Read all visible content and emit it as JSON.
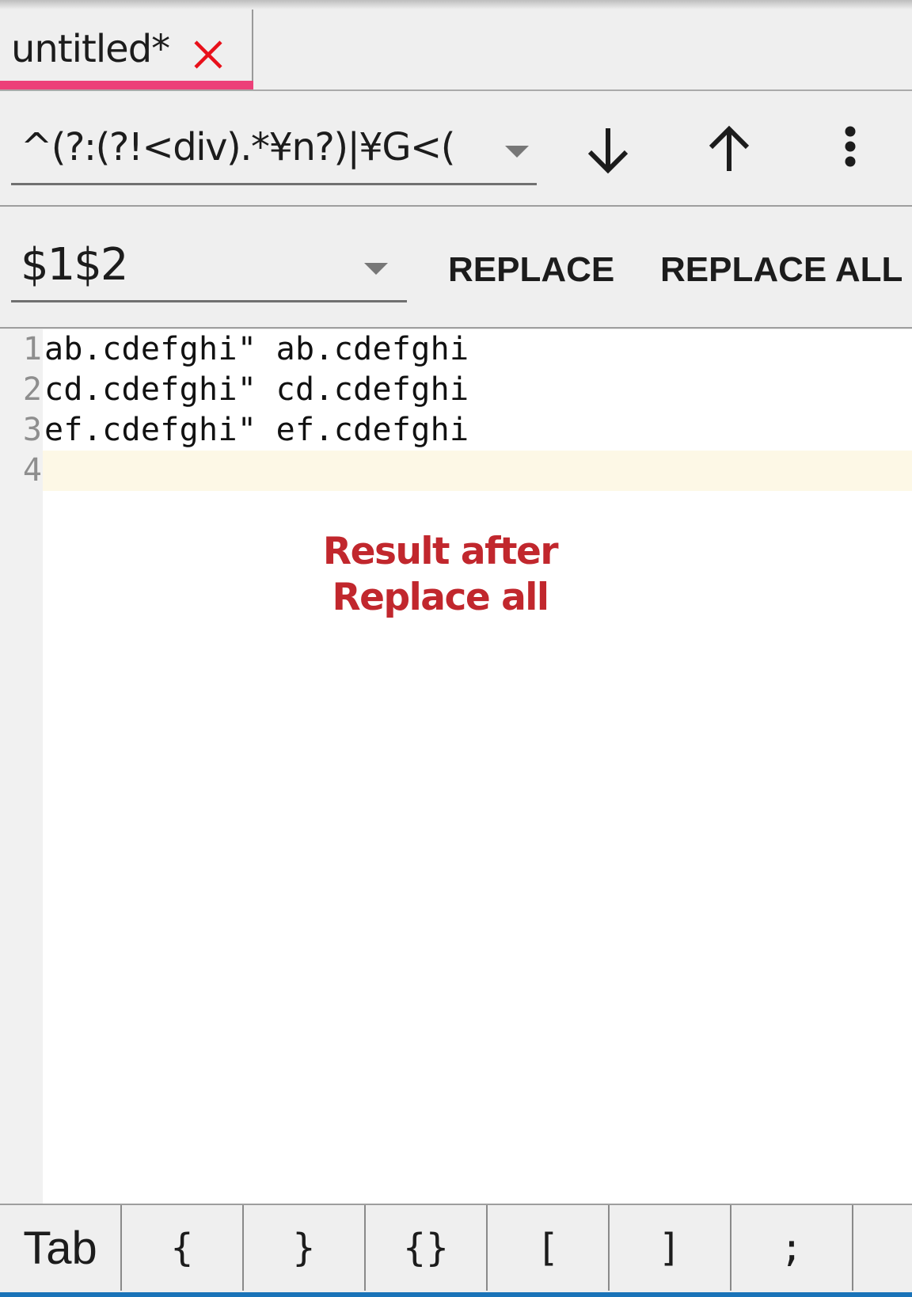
{
  "tab": {
    "title": "untitled*",
    "close_icon": "close-x-icon",
    "accent_color": "#ec4079",
    "close_color": "#e8101a"
  },
  "search": {
    "value": "^(?:(?!<div).*¥n?)|¥G<(",
    "dropdown_icon": "dropdown-triangle-icon",
    "next_icon": "arrow-down-icon",
    "prev_icon": "arrow-up-icon",
    "menu_icon": "more-vertical-icon"
  },
  "replace": {
    "value": "$1$2",
    "dropdown_icon": "dropdown-triangle-icon",
    "replace_label": "REPLACE",
    "replace_all_label": "REPLACE ALL"
  },
  "editor": {
    "lines": [
      {
        "number": "1",
        "text": "ab.cdefghi\" ab.cdefghi"
      },
      {
        "number": "2",
        "text": "cd.cdefghi\" cd.cdefghi"
      },
      {
        "number": "3",
        "text": "ef.cdefghi\" ef.cdefghi"
      },
      {
        "number": "4",
        "text": ""
      }
    ],
    "current_line": 4,
    "annotation_line1": "Result after",
    "annotation_line2": "Replace all",
    "annotation_color": "#c1272d"
  },
  "keybar": {
    "keys": [
      "Tab",
      "{",
      "}",
      "{}",
      "[",
      "]",
      ";",
      ""
    ]
  }
}
